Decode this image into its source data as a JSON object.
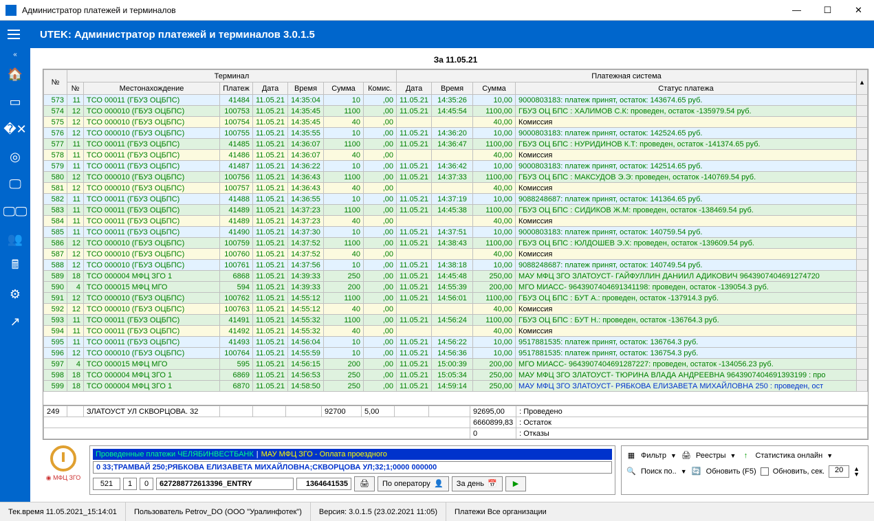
{
  "window": {
    "title": "Администратор платежей и терминалов",
    "app_title": "UTEK: Администратор платежей и терминалов 3.0.1.5"
  },
  "date_header": "За 11.05.21",
  "columns": {
    "group_terminal": "Терминал",
    "group_paysys": "Платежная система",
    "idx": "№",
    "tn": "№",
    "loc": "Местонахождение",
    "plat": "Платеж",
    "date": "Дата",
    "time": "Время",
    "sum": "Сумма",
    "komis": "Комис.",
    "pdate": "Дата",
    "ptime": "Время",
    "psum": "Сумма",
    "status": "Статус платежа"
  },
  "rows": [
    {
      "cls": "row-blue",
      "idx": "573",
      "tn": "11",
      "loc": "ТСО 00011 (ГБУЗ ОЦБПС)",
      "plat": "41484",
      "date": "11.05.21",
      "time": "14:35:04",
      "sum": "10",
      "kom": ",00",
      "pdate": "11.05.21",
      "ptime": "14:35:26",
      "psum": "10,00",
      "status": "9000803183: платеж принят, остаток: 143674.65 руб.",
      "scol": "green"
    },
    {
      "cls": "row-green",
      "idx": "574",
      "tn": "12",
      "loc": "ТСО 000010 (ГБУЗ ОЦБПС)",
      "plat": "100753",
      "date": "11.05.21",
      "time": "14:35:45",
      "sum": "1100",
      "kom": ",00",
      "pdate": "11.05.21",
      "ptime": "14:45:54",
      "psum": "1100,00",
      "status": "ГБУЗ ОЦ БПС : ХАЛИМОВ С.К: проведен, остаток -135979.54 руб.",
      "scol": "green"
    },
    {
      "cls": "row-cream",
      "idx": "575",
      "tn": "12",
      "loc": "ТСО 000010 (ГБУЗ ОЦБПС)",
      "plat": "100754",
      "date": "11.05.21",
      "time": "14:35:45",
      "sum": "40",
      "kom": ",00",
      "pdate": "",
      "ptime": "",
      "psum": "40,00",
      "status": "Комиссия",
      "scol": "black"
    },
    {
      "cls": "row-blue",
      "idx": "576",
      "tn": "12",
      "loc": "ТСО 000010 (ГБУЗ ОЦБПС)",
      "plat": "100755",
      "date": "11.05.21",
      "time": "14:35:55",
      "sum": "10",
      "kom": ",00",
      "pdate": "11.05.21",
      "ptime": "14:36:20",
      "psum": "10,00",
      "status": "9000803183: платеж принят, остаток: 142524.65 руб.",
      "scol": "green"
    },
    {
      "cls": "row-green",
      "idx": "577",
      "tn": "11",
      "loc": "ТСО 00011 (ГБУЗ ОЦБПС)",
      "plat": "41485",
      "date": "11.05.21",
      "time": "14:36:07",
      "sum": "1100",
      "kom": ",00",
      "pdate": "11.05.21",
      "ptime": "14:36:47",
      "psum": "1100,00",
      "status": "ГБУЗ ОЦ БПС : НУРИДИНОВ К.Т: проведен, остаток -141374.65 руб.",
      "scol": "green"
    },
    {
      "cls": "row-cream",
      "idx": "578",
      "tn": "11",
      "loc": "ТСО 00011 (ГБУЗ ОЦБПС)",
      "plat": "41486",
      "date": "11.05.21",
      "time": "14:36:07",
      "sum": "40",
      "kom": ",00",
      "pdate": "",
      "ptime": "",
      "psum": "40,00",
      "status": "Комиссия",
      "scol": "black"
    },
    {
      "cls": "row-blue",
      "idx": "579",
      "tn": "11",
      "loc": "ТСО 00011 (ГБУЗ ОЦБПС)",
      "plat": "41487",
      "date": "11.05.21",
      "time": "14:36:22",
      "sum": "10",
      "kom": ",00",
      "pdate": "11.05.21",
      "ptime": "14:36:42",
      "psum": "10,00",
      "status": "9000803183: платеж принят, остаток: 142514.65 руб.",
      "scol": "green"
    },
    {
      "cls": "row-green",
      "idx": "580",
      "tn": "12",
      "loc": "ТСО 000010 (ГБУЗ ОЦБПС)",
      "plat": "100756",
      "date": "11.05.21",
      "time": "14:36:43",
      "sum": "1100",
      "kom": ",00",
      "pdate": "11.05.21",
      "ptime": "14:37:33",
      "psum": "1100,00",
      "status": "ГБУЗ ОЦ БПС : МАКСУДОВ Э.Э: проведен, остаток -140769.54 руб.",
      "scol": "green"
    },
    {
      "cls": "row-cream",
      "idx": "581",
      "tn": "12",
      "loc": "ТСО 000010 (ГБУЗ ОЦБПС)",
      "plat": "100757",
      "date": "11.05.21",
      "time": "14:36:43",
      "sum": "40",
      "kom": ",00",
      "pdate": "",
      "ptime": "",
      "psum": "40,00",
      "status": "Комиссия",
      "scol": "black"
    },
    {
      "cls": "row-blue",
      "idx": "582",
      "tn": "11",
      "loc": "ТСО 00011 (ГБУЗ ОЦБПС)",
      "plat": "41488",
      "date": "11.05.21",
      "time": "14:36:55",
      "sum": "10",
      "kom": ",00",
      "pdate": "11.05.21",
      "ptime": "14:37:19",
      "psum": "10,00",
      "status": "9088248687: платеж принят, остаток: 141364.65 руб.",
      "scol": "green"
    },
    {
      "cls": "row-green",
      "idx": "583",
      "tn": "11",
      "loc": "ТСО 00011 (ГБУЗ ОЦБПС)",
      "plat": "41489",
      "date": "11.05.21",
      "time": "14:37:23",
      "sum": "1100",
      "kom": ",00",
      "pdate": "11.05.21",
      "ptime": "14:45:38",
      "psum": "1100,00",
      "status": "ГБУЗ ОЦ БПС : СИДИКОВ Ж.М: проведен, остаток -138469.54 руб.",
      "scol": "green"
    },
    {
      "cls": "row-cream",
      "idx": "584",
      "tn": "11",
      "loc": "ТСО 00011 (ГБУЗ ОЦБПС)",
      "plat": "41489",
      "date": "11.05.21",
      "time": "14:37:23",
      "sum": "40",
      "kom": ",00",
      "pdate": "",
      "ptime": "",
      "psum": "40,00",
      "status": "Комиссия",
      "scol": "black"
    },
    {
      "cls": "row-blue",
      "idx": "585",
      "tn": "11",
      "loc": "ТСО 00011 (ГБУЗ ОЦБПС)",
      "plat": "41490",
      "date": "11.05.21",
      "time": "14:37:30",
      "sum": "10",
      "kom": ",00",
      "pdate": "11.05.21",
      "ptime": "14:37:51",
      "psum": "10,00",
      "status": "9000803183: платеж принят, остаток: 140759.54 руб.",
      "scol": "green"
    },
    {
      "cls": "row-green",
      "idx": "586",
      "tn": "12",
      "loc": "ТСО 000010 (ГБУЗ ОЦБПС)",
      "plat": "100759",
      "date": "11.05.21",
      "time": "14:37:52",
      "sum": "1100",
      "kom": ",00",
      "pdate": "11.05.21",
      "ptime": "14:38:43",
      "psum": "1100,00",
      "status": "ГБУЗ ОЦ БПС : ЮЛДОШЕВ Э.Х: проведен, остаток -139609.54 руб.",
      "scol": "green"
    },
    {
      "cls": "row-cream",
      "idx": "587",
      "tn": "12",
      "loc": "ТСО 000010 (ГБУЗ ОЦБПС)",
      "plat": "100760",
      "date": "11.05.21",
      "time": "14:37:52",
      "sum": "40",
      "kom": ",00",
      "pdate": "",
      "ptime": "",
      "psum": "40,00",
      "status": "Комиссия",
      "scol": "black"
    },
    {
      "cls": "row-blue",
      "idx": "588",
      "tn": "12",
      "loc": "ТСО 000010 (ГБУЗ ОЦБПС)",
      "plat": "100761",
      "date": "11.05.21",
      "time": "14:37:56",
      "sum": "10",
      "kom": ",00",
      "pdate": "11.05.21",
      "ptime": "14:38:18",
      "psum": "10,00",
      "status": "9088248687: платеж принят, остаток: 140749.54 руб.",
      "scol": "green"
    },
    {
      "cls": "row-green",
      "idx": "589",
      "tn": "18",
      "loc": "ТСО 000004 МФЦ ЗГО 1",
      "plat": "6868",
      "date": "11.05.21",
      "time": "14:39:33",
      "sum": "250",
      "kom": ",00",
      "pdate": "11.05.21",
      "ptime": "14:45:48",
      "psum": "250,00",
      "status": "МАУ МФЦ ЗГО ЗЛАТОУСТ- ГАЙФУЛЛИН ДАНИИЛ АДИКОВИЧ 9643907404691274720",
      "scol": "green"
    },
    {
      "cls": "row-green",
      "idx": "590",
      "tn": "4",
      "loc": "ТСО 000015 МФЦ МГО",
      "plat": "594",
      "date": "11.05.21",
      "time": "14:39:33",
      "sum": "200",
      "kom": ",00",
      "pdate": "11.05.21",
      "ptime": "14:55:39",
      "psum": "200,00",
      "status": "МГО МИАСС- 9643907404691341198: проведен, остаток -139054.3 руб.",
      "scol": "green"
    },
    {
      "cls": "row-green",
      "idx": "591",
      "tn": "12",
      "loc": "ТСО 000010 (ГБУЗ ОЦБПС)",
      "plat": "100762",
      "date": "11.05.21",
      "time": "14:55:12",
      "sum": "1100",
      "kom": ",00",
      "pdate": "11.05.21",
      "ptime": "14:56:01",
      "psum": "1100,00",
      "status": "ГБУЗ ОЦ БПС : БУТ А.: проведен, остаток -137914.3 руб.",
      "scol": "green"
    },
    {
      "cls": "row-cream",
      "idx": "592",
      "tn": "12",
      "loc": "ТСО 000010 (ГБУЗ ОЦБПС)",
      "plat": "100763",
      "date": "11.05.21",
      "time": "14:55:12",
      "sum": "40",
      "kom": ",00",
      "pdate": "",
      "ptime": "",
      "psum": "40,00",
      "status": "Комиссия",
      "scol": "black"
    },
    {
      "cls": "row-green",
      "idx": "593",
      "tn": "11",
      "loc": "ТСО 00011 (ГБУЗ ОЦБПС)",
      "plat": "41491",
      "date": "11.05.21",
      "time": "14:55:32",
      "sum": "1100",
      "kom": ",00",
      "pdate": "11.05.21",
      "ptime": "14:56:24",
      "psum": "1100,00",
      "status": "ГБУЗ ОЦ БПС : БУТ Н.: проведен, остаток -136764.3 руб.",
      "scol": "green"
    },
    {
      "cls": "row-cream",
      "idx": "594",
      "tn": "11",
      "loc": "ТСО 00011 (ГБУЗ ОЦБПС)",
      "plat": "41492",
      "date": "11.05.21",
      "time": "14:55:32",
      "sum": "40",
      "kom": ",00",
      "pdate": "",
      "ptime": "",
      "psum": "40,00",
      "status": "Комиссия",
      "scol": "black"
    },
    {
      "cls": "row-blue",
      "idx": "595",
      "tn": "11",
      "loc": "ТСО 00011 (ГБУЗ ОЦБПС)",
      "plat": "41493",
      "date": "11.05.21",
      "time": "14:56:04",
      "sum": "10",
      "kom": ",00",
      "pdate": "11.05.21",
      "ptime": "14:56:22",
      "psum": "10,00",
      "status": "9517881535: платеж принят, остаток: 136764.3 руб.",
      "scol": "green"
    },
    {
      "cls": "row-blue",
      "idx": "596",
      "tn": "12",
      "loc": "ТСО 000010 (ГБУЗ ОЦБПС)",
      "plat": "100764",
      "date": "11.05.21",
      "time": "14:55:59",
      "sum": "10",
      "kom": ",00",
      "pdate": "11.05.21",
      "ptime": "14:56:36",
      "psum": "10,00",
      "status": "9517881535: платеж принят, остаток: 136754.3 руб.",
      "scol": "green"
    },
    {
      "cls": "row-green",
      "idx": "597",
      "tn": "4",
      "loc": "ТСО 000015 МФЦ МГО",
      "plat": "595",
      "date": "11.05.21",
      "time": "14:56:15",
      "sum": "200",
      "kom": ",00",
      "pdate": "11.05.21",
      "ptime": "15:00:39",
      "psum": "200,00",
      "status": "МГО МИАСС- 9643907404691287227: проведен, остаток -134056.23 руб.",
      "scol": "green"
    },
    {
      "cls": "row-green",
      "idx": "598",
      "tn": "18",
      "loc": "ТСО 000004 МФЦ ЗГО 1",
      "plat": "6869",
      "date": "11.05.21",
      "time": "14:56:53",
      "sum": "250",
      "kom": ",00",
      "pdate": "11.05.21",
      "ptime": "15:05:34",
      "psum": "250,00",
      "status": "МАУ МФЦ ЗГО ЗЛАТОУСТ- ТЮРИНА ВЛАДА АНДРЕЕВНА 9643907404691393199  : про",
      "scol": "green"
    },
    {
      "cls": "row-green",
      "idx": "599",
      "tn": "18",
      "loc": "ТСО 000004 МФЦ ЗГО 1",
      "plat": "6870",
      "date": "11.05.21",
      "time": "14:58:50",
      "sum": "250",
      "kom": ",00",
      "pdate": "11.05.21",
      "ptime": "14:59:14",
      "psum": "250,00",
      "status": "МАУ МФЦ ЗГО ЗЛАТОУСТ- РЯБКОВА ЕЛИЗАВЕТА МИХАЙЛОВНА 250  : проведен, ост",
      "scol": "blue"
    }
  ],
  "summary": {
    "count": "249",
    "addr": "ЗЛАТОУСТ УЛ СКВОРЦОВА. 32",
    "sum": "92700",
    "kom": "5,00",
    "psum": "92695,00",
    "status1": ": Проведено",
    "balance": "6660899,83",
    "status2": ": Остаток",
    "zero": "0",
    "status3": ": Отказы"
  },
  "info": {
    "line1a": "Проведенные платежи ЧЕЛЯБИНВЕСТБАНК",
    "line1b": "МАУ МФЦ ЗГО - Оплата проездного",
    "line2": "0 33;ТРАМВАЙ 250;РЯБКОВА ЕЛИЗАВЕТА МИХАЙЛОВНА;СКВОРЦОВА УЛ;32;1;0000 000000",
    "box1": "521",
    "box2": "1",
    "box3": "0",
    "box4": "627288772613396_ENTRY",
    "box5": "1364641535",
    "logo": "МФЦ ЗГО"
  },
  "buttons": {
    "by_operator": "По оператору",
    "by_day": "За день",
    "filter": "Фильтр",
    "registers": "Реестры",
    "stats": "Статистика онлайн",
    "search": "Поиск по..",
    "refresh": "Обновить (F5)",
    "auto_refresh": "Обновить, сек.",
    "auto_refresh_val": "20"
  },
  "statusbar": {
    "time_lbl": "Тек.время",
    "time": "11.05.2021_15:14:01",
    "user_lbl": "Пользователь",
    "user": "Petrov_DO (ООО \"Уралинфотек\")",
    "ver_lbl": "Версия:",
    "ver": "3.0.1.5 (23.02.2021 11:05)",
    "pay_lbl": "Платежи",
    "pay": "Все организации"
  }
}
